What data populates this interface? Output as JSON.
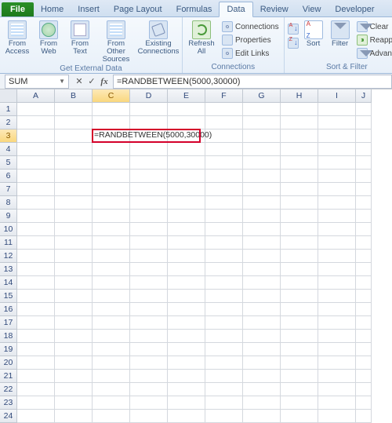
{
  "tabs": {
    "file": "File",
    "home": "Home",
    "insert": "Insert",
    "pagelayout": "Page Layout",
    "formulas": "Formulas",
    "data": "Data",
    "review": "Review",
    "view": "View",
    "developer": "Developer"
  },
  "ribbon": {
    "ext": {
      "access": "From\nAccess",
      "web": "From\nWeb",
      "text": "From\nText",
      "other": "From Other\nSources",
      "existing": "Existing\nConnections",
      "group": "Get External Data"
    },
    "conn": {
      "refresh": "Refresh\nAll",
      "connections": "Connections",
      "properties": "Properties",
      "editlinks": "Edit Links",
      "group": "Connections"
    },
    "sort": {
      "sort": "Sort",
      "filter": "Filter",
      "clear": "Clear",
      "reapply": "Reapply",
      "advanced": "Advanced",
      "group": "Sort & Filter"
    }
  },
  "formula_bar": {
    "namebox": "SUM",
    "formula": "=RANDBETWEEN(5000,30000)"
  },
  "columns": [
    "A",
    "B",
    "C",
    "D",
    "E",
    "F",
    "G",
    "H",
    "I",
    "J"
  ],
  "rows": [
    "1",
    "2",
    "3",
    "4",
    "5",
    "6",
    "7",
    "8",
    "9",
    "10",
    "11",
    "12",
    "13",
    "14",
    "15",
    "16",
    "17",
    "18",
    "19",
    "20",
    "21",
    "22",
    "23",
    "24"
  ],
  "active": {
    "col": "C",
    "row": "3"
  },
  "cell_content": {
    "C3": "=RANDBETWEEN(5000,30000)"
  }
}
